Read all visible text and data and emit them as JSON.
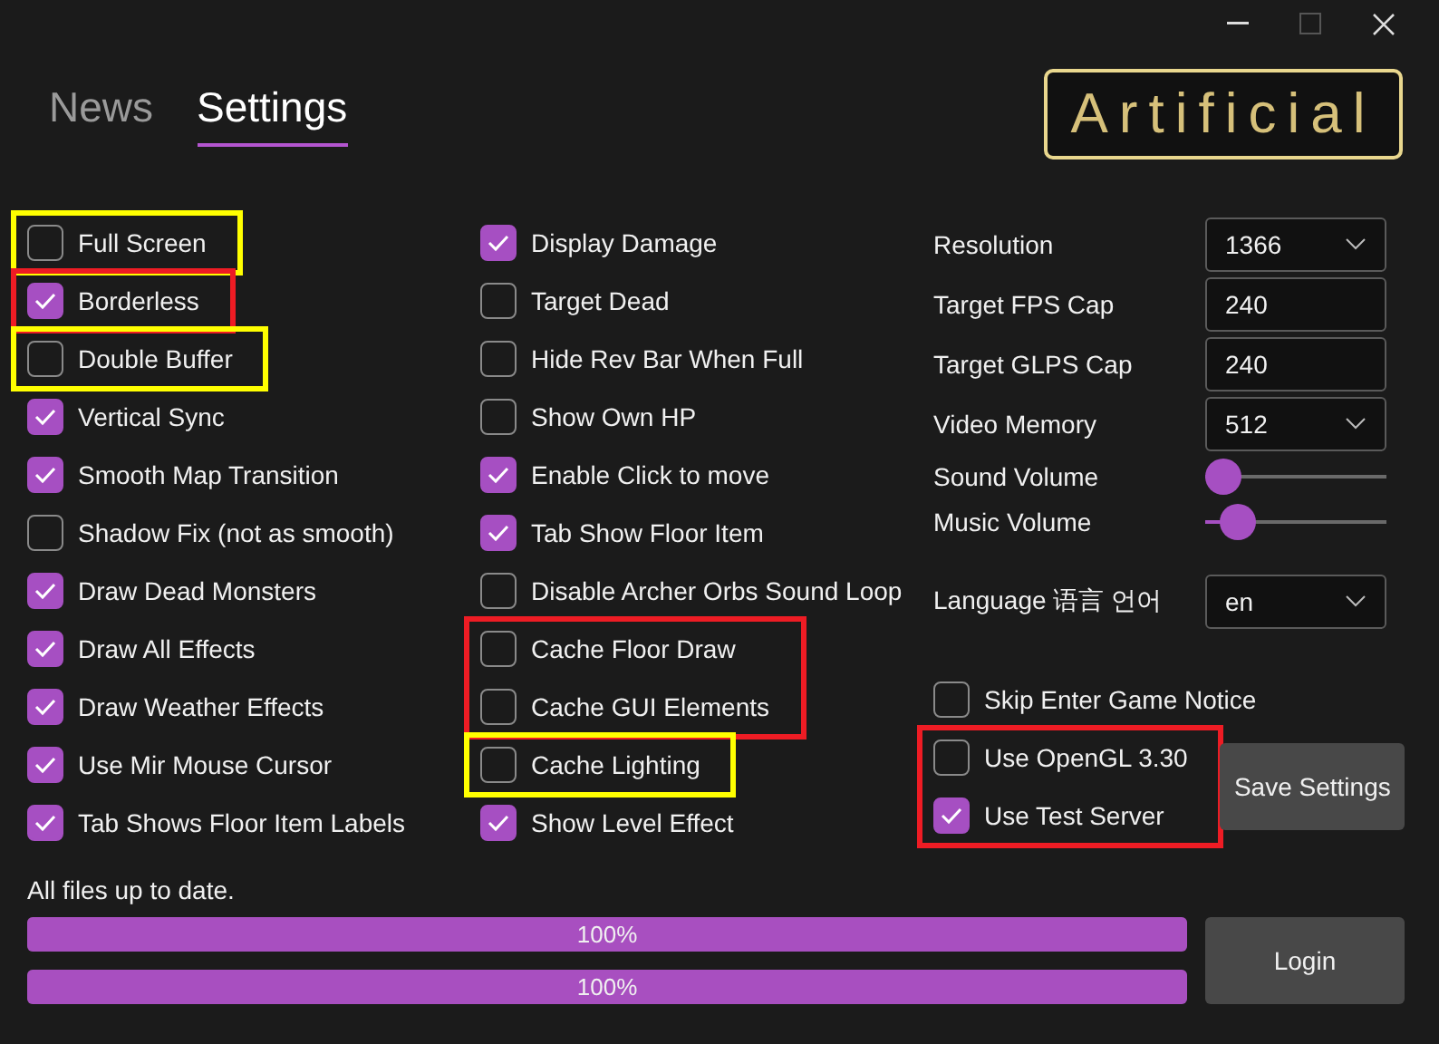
{
  "tabs": [
    {
      "label": "News",
      "selected": false
    },
    {
      "label": "Settings",
      "selected": true
    }
  ],
  "logo": {
    "text": "Artificial"
  },
  "columns": [
    {
      "groups": [
        {
          "color": "#ffff00",
          "items": [
            {
              "label": "Full Screen",
              "checked": false
            }
          ]
        },
        {
          "color": "#ee1c24",
          "items": [
            {
              "label": "Borderless",
              "checked": true
            }
          ]
        },
        {
          "color": "#ffff00",
          "items": [
            {
              "label": "Double Buffer",
              "checked": false
            }
          ]
        },
        {
          "items": [
            {
              "label": "Vertical Sync",
              "checked": true
            },
            {
              "label": "Smooth Map Transition",
              "checked": true
            },
            {
              "label": "Shadow Fix (not as smooth)",
              "checked": false
            },
            {
              "label": "Draw Dead Monsters",
              "checked": true
            },
            {
              "label": "Draw All Effects",
              "checked": true
            },
            {
              "label": "Draw Weather Effects",
              "checked": true
            },
            {
              "label": "Use Mir Mouse Cursor",
              "checked": true
            },
            {
              "label": "Tab Shows Floor Item Labels",
              "checked": true
            }
          ]
        }
      ]
    },
    {
      "groups": [
        {
          "items": [
            {
              "label": "Display Damage",
              "checked": true
            },
            {
              "label": "Target Dead",
              "checked": false
            },
            {
              "label": "Hide Rev Bar When Full",
              "checked": false
            },
            {
              "label": "Show Own HP",
              "checked": false
            },
            {
              "label": "Enable Click to move",
              "checked": true
            },
            {
              "label": "Tab Show Floor Item",
              "checked": true
            },
            {
              "label": "Disable Archer Orbs Sound Loop",
              "checked": false
            }
          ]
        },
        {
          "color": "#ee1c24",
          "items": [
            {
              "label": "Cache Floor Draw",
              "checked": false
            },
            {
              "label": "Cache GUI Elements",
              "checked": false
            }
          ]
        },
        {
          "color": "#ffff00",
          "items": [
            {
              "label": "Cache Lighting",
              "checked": false
            }
          ]
        },
        {
          "items": [
            {
              "label": "Show Level Effect",
              "checked": true
            }
          ]
        }
      ]
    }
  ],
  "settings": [
    {
      "kind": "dropdown",
      "label": "Resolution",
      "value": "1366"
    },
    {
      "kind": "input",
      "label": "Target FPS Cap",
      "value": "240"
    },
    {
      "kind": "input",
      "label": "Target GLPS Cap",
      "value": "240"
    },
    {
      "kind": "dropdown",
      "label": "Video Memory",
      "value": "512"
    },
    {
      "kind": "slider",
      "label": "Sound Volume",
      "level": 0
    },
    {
      "kind": "slider",
      "label": "Music Volume",
      "level": 0.1
    },
    {
      "kind": "dropdown",
      "label": "Language 语言 언어",
      "value": "en"
    }
  ],
  "extra_options": {
    "groups": [
      {
        "items": [
          {
            "label": "Skip Enter Game Notice",
            "checked": false
          }
        ]
      }
    ]
  },
  "server_options": {
    "groups": [
      {
        "color": "#ee1c24",
        "items": [
          {
            "label": "Use OpenGL 3.30",
            "checked": false
          },
          {
            "label": "Use Test Server",
            "checked": true
          }
        ]
      }
    ]
  },
  "save_button": "Save Settings",
  "status": "All files up to date.",
  "progress": [
    {
      "level": 1,
      "reading": "100%"
    },
    {
      "level": 1,
      "reading": "100%"
    }
  ],
  "login_button": "Login"
}
